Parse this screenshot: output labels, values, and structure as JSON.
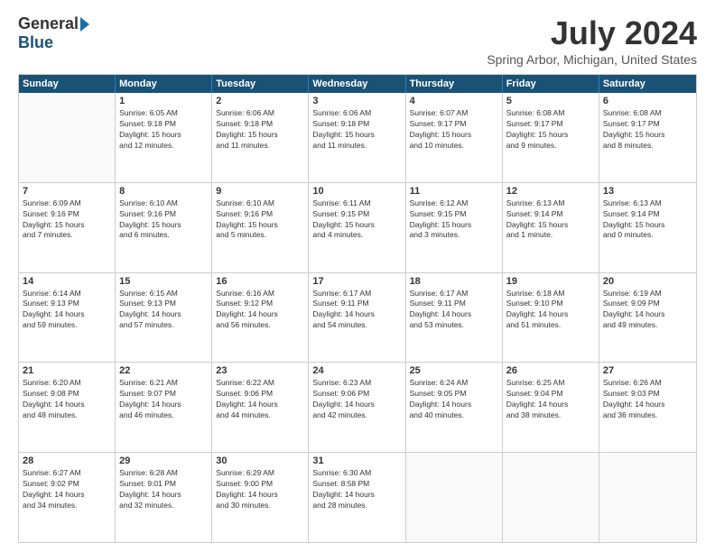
{
  "logo": {
    "general": "General",
    "blue": "Blue"
  },
  "title": "July 2024",
  "subtitle": "Spring Arbor, Michigan, United States",
  "days": [
    "Sunday",
    "Monday",
    "Tuesday",
    "Wednesday",
    "Thursday",
    "Friday",
    "Saturday"
  ],
  "weeks": [
    [
      {
        "day": "",
        "text": ""
      },
      {
        "day": "1",
        "text": "Sunrise: 6:05 AM\nSunset: 9:18 PM\nDaylight: 15 hours\nand 12 minutes."
      },
      {
        "day": "2",
        "text": "Sunrise: 6:06 AM\nSunset: 9:18 PM\nDaylight: 15 hours\nand 11 minutes."
      },
      {
        "day": "3",
        "text": "Sunrise: 6:06 AM\nSunset: 9:18 PM\nDaylight: 15 hours\nand 11 minutes."
      },
      {
        "day": "4",
        "text": "Sunrise: 6:07 AM\nSunset: 9:17 PM\nDaylight: 15 hours\nand 10 minutes."
      },
      {
        "day": "5",
        "text": "Sunrise: 6:08 AM\nSunset: 9:17 PM\nDaylight: 15 hours\nand 9 minutes."
      },
      {
        "day": "6",
        "text": "Sunrise: 6:08 AM\nSunset: 9:17 PM\nDaylight: 15 hours\nand 8 minutes."
      }
    ],
    [
      {
        "day": "7",
        "text": "Sunrise: 6:09 AM\nSunset: 9:16 PM\nDaylight: 15 hours\nand 7 minutes."
      },
      {
        "day": "8",
        "text": "Sunrise: 6:10 AM\nSunset: 9:16 PM\nDaylight: 15 hours\nand 6 minutes."
      },
      {
        "day": "9",
        "text": "Sunrise: 6:10 AM\nSunset: 9:16 PM\nDaylight: 15 hours\nand 5 minutes."
      },
      {
        "day": "10",
        "text": "Sunrise: 6:11 AM\nSunset: 9:15 PM\nDaylight: 15 hours\nand 4 minutes."
      },
      {
        "day": "11",
        "text": "Sunrise: 6:12 AM\nSunset: 9:15 PM\nDaylight: 15 hours\nand 3 minutes."
      },
      {
        "day": "12",
        "text": "Sunrise: 6:13 AM\nSunset: 9:14 PM\nDaylight: 15 hours\nand 1 minute."
      },
      {
        "day": "13",
        "text": "Sunrise: 6:13 AM\nSunset: 9:14 PM\nDaylight: 15 hours\nand 0 minutes."
      }
    ],
    [
      {
        "day": "14",
        "text": "Sunrise: 6:14 AM\nSunset: 9:13 PM\nDaylight: 14 hours\nand 59 minutes."
      },
      {
        "day": "15",
        "text": "Sunrise: 6:15 AM\nSunset: 9:13 PM\nDaylight: 14 hours\nand 57 minutes."
      },
      {
        "day": "16",
        "text": "Sunrise: 6:16 AM\nSunset: 9:12 PM\nDaylight: 14 hours\nand 56 minutes."
      },
      {
        "day": "17",
        "text": "Sunrise: 6:17 AM\nSunset: 9:11 PM\nDaylight: 14 hours\nand 54 minutes."
      },
      {
        "day": "18",
        "text": "Sunrise: 6:17 AM\nSunset: 9:11 PM\nDaylight: 14 hours\nand 53 minutes."
      },
      {
        "day": "19",
        "text": "Sunrise: 6:18 AM\nSunset: 9:10 PM\nDaylight: 14 hours\nand 51 minutes."
      },
      {
        "day": "20",
        "text": "Sunrise: 6:19 AM\nSunset: 9:09 PM\nDaylight: 14 hours\nand 49 minutes."
      }
    ],
    [
      {
        "day": "21",
        "text": "Sunrise: 6:20 AM\nSunset: 9:08 PM\nDaylight: 14 hours\nand 48 minutes."
      },
      {
        "day": "22",
        "text": "Sunrise: 6:21 AM\nSunset: 9:07 PM\nDaylight: 14 hours\nand 46 minutes."
      },
      {
        "day": "23",
        "text": "Sunrise: 6:22 AM\nSunset: 9:06 PM\nDaylight: 14 hours\nand 44 minutes."
      },
      {
        "day": "24",
        "text": "Sunrise: 6:23 AM\nSunset: 9:06 PM\nDaylight: 14 hours\nand 42 minutes."
      },
      {
        "day": "25",
        "text": "Sunrise: 6:24 AM\nSunset: 9:05 PM\nDaylight: 14 hours\nand 40 minutes."
      },
      {
        "day": "26",
        "text": "Sunrise: 6:25 AM\nSunset: 9:04 PM\nDaylight: 14 hours\nand 38 minutes."
      },
      {
        "day": "27",
        "text": "Sunrise: 6:26 AM\nSunset: 9:03 PM\nDaylight: 14 hours\nand 36 minutes."
      }
    ],
    [
      {
        "day": "28",
        "text": "Sunrise: 6:27 AM\nSunset: 9:02 PM\nDaylight: 14 hours\nand 34 minutes."
      },
      {
        "day": "29",
        "text": "Sunrise: 6:28 AM\nSunset: 9:01 PM\nDaylight: 14 hours\nand 32 minutes."
      },
      {
        "day": "30",
        "text": "Sunrise: 6:29 AM\nSunset: 9:00 PM\nDaylight: 14 hours\nand 30 minutes."
      },
      {
        "day": "31",
        "text": "Sunrise: 6:30 AM\nSunset: 8:58 PM\nDaylight: 14 hours\nand 28 minutes."
      },
      {
        "day": "",
        "text": ""
      },
      {
        "day": "",
        "text": ""
      },
      {
        "day": "",
        "text": ""
      }
    ]
  ]
}
